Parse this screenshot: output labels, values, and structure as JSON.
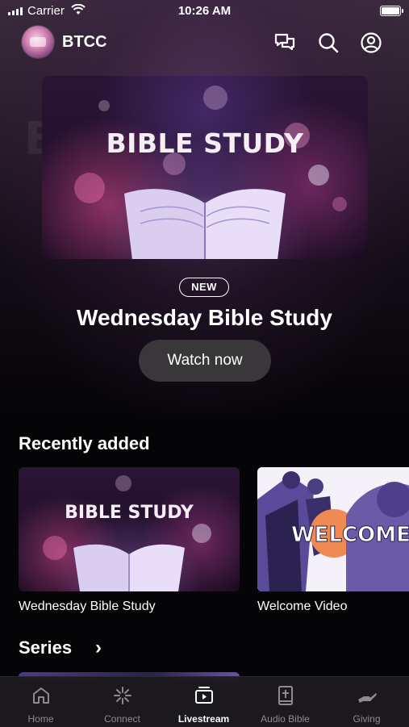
{
  "status_bar": {
    "carrier": "Carrier",
    "time": "10:26 AM"
  },
  "header": {
    "brand": "BTCC",
    "icons": [
      "chat-icon",
      "search-icon",
      "account-icon"
    ]
  },
  "hero": {
    "image_text": "BIBLE STUDY",
    "badge": "NEW",
    "title": "Wednesday Bible Study",
    "button": "Watch now"
  },
  "recently_added": {
    "title": "Recently added",
    "items": [
      {
        "image_text": "BIBLE STUDY",
        "label": "Wednesday Bible Study"
      },
      {
        "image_text": "WELCOME HO",
        "label": "Welcome Video"
      }
    ]
  },
  "series": {
    "title": "Series",
    "chevron": "›"
  },
  "tabs": [
    {
      "label": "Home",
      "icon": "home-icon",
      "active": false
    },
    {
      "label": "Connect",
      "icon": "connect-icon",
      "active": false
    },
    {
      "label": "Livestream",
      "icon": "livestream-icon",
      "active": true
    },
    {
      "label": "Audio Bible",
      "icon": "audio-bible-icon",
      "active": false
    },
    {
      "label": "Giving",
      "icon": "giving-icon",
      "active": false
    }
  ],
  "colors": {
    "background": "#050407",
    "button": "#3a373b",
    "tab_inactive": "#8d8a90",
    "tab_active": "#ffffff",
    "accent_purple": "#7a4aa0"
  }
}
